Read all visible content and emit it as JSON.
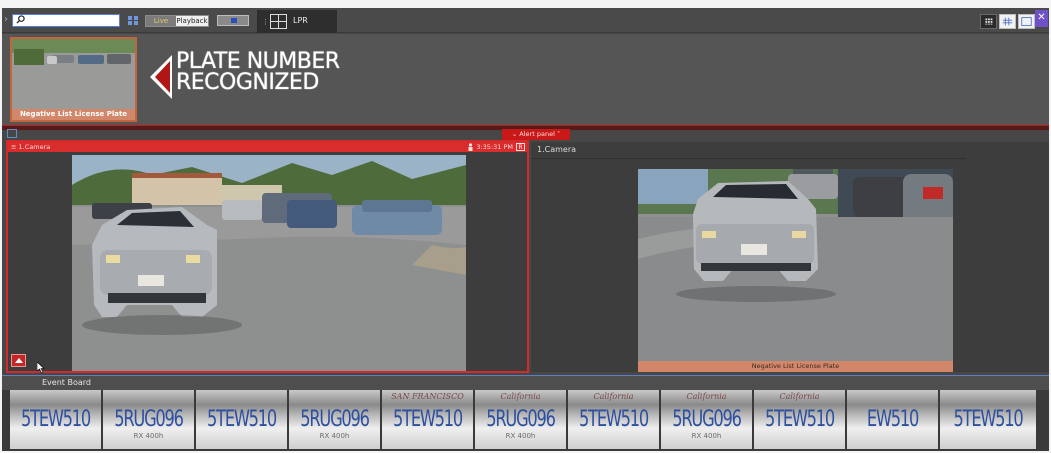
{
  "toolbar": {
    "search_value": "",
    "live_label": "Live",
    "playback_label": "Playback",
    "tab_label": "LPR"
  },
  "banner": {
    "thumb_caption": "Negative List License Plate",
    "headline_line1": "PLATE NUMBER",
    "headline_line2": "RECOGNIZED"
  },
  "alert_panel": {
    "label": "Alert panel"
  },
  "left_camera": {
    "title": "1.Camera",
    "time": "3:35:31 PM",
    "rec_label": "R"
  },
  "right_camera": {
    "title": "1.Camera",
    "caption": "Negative List License Plate"
  },
  "event_board": {
    "label": "Event Board",
    "plates": [
      {
        "state": "",
        "number": "5TEW510",
        "sub": ""
      },
      {
        "state": "",
        "number": "5RUG096",
        "sub": "RX 400h"
      },
      {
        "state": "",
        "number": "5TEW510",
        "sub": ""
      },
      {
        "state": "",
        "number": "5RUG096",
        "sub": "RX 400h"
      },
      {
        "state": "SAN FRANCISCO",
        "number": "5TEW510",
        "sub": ""
      },
      {
        "state": "California",
        "number": "5RUG096",
        "sub": "RX 400h"
      },
      {
        "state": "California",
        "number": "5TEW510",
        "sub": ""
      },
      {
        "state": "California",
        "number": "5RUG096",
        "sub": "RX 400h"
      },
      {
        "state": "California",
        "number": "5TEW510",
        "sub": ""
      },
      {
        "state": "",
        "number": "EW510",
        "sub": ""
      },
      {
        "state": "",
        "number": "5TEW510",
        "sub": ""
      }
    ]
  },
  "colors": {
    "alert_red": "#d62a2a",
    "caption_salmon": "#d3876a",
    "plate_blue": "#2d4fa0"
  }
}
